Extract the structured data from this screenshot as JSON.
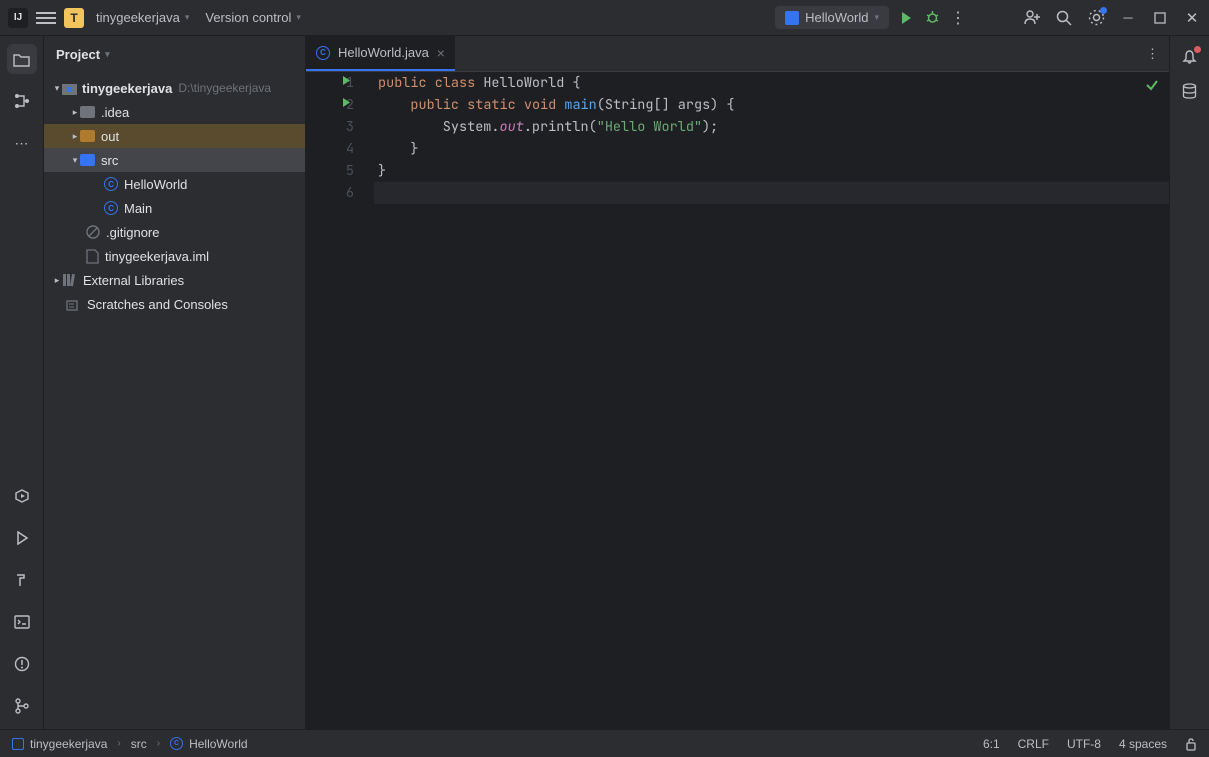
{
  "titlebar": {
    "project_initial": "T",
    "project_name": "tinygeekerjava",
    "vcs_menu": "Version control",
    "run_config": "HelloWorld"
  },
  "sidebar": {
    "header": "Project",
    "root": {
      "name": "tinygeekerjava",
      "path": "D:\\tinygeekerjava"
    },
    "idea": ".idea",
    "out": "out",
    "src": "src",
    "class1": "HelloWorld",
    "class2": "Main",
    "gitignore": ".gitignore",
    "iml": "tinygeekerjava.iml",
    "ext": "External Libraries",
    "scratch": "Scratches and Consoles"
  },
  "tab": {
    "name": "HelloWorld.java"
  },
  "code": {
    "l1_a": "public",
    "l1_b": "class",
    "l1_c": "HelloWorld",
    "l1_d": " {",
    "l2_a": "    ",
    "l2_b": "public",
    "l2_c": "static",
    "l2_d": "void",
    "l2_e": "main",
    "l2_f": "(String[] args) {",
    "l3_a": "        System.",
    "l3_b": "out",
    "l3_c": ".println(",
    "l3_d": "\"Hello World\"",
    "l3_e": ");",
    "l4": "    }",
    "l5": "}"
  },
  "gutter": {
    "1": "1",
    "2": "2",
    "3": "3",
    "4": "4",
    "5": "5",
    "6": "6"
  },
  "status": {
    "crumb1": "tinygeekerjava",
    "crumb2": "src",
    "crumb3": "HelloWorld",
    "pos": "6:1",
    "le": "CRLF",
    "enc": "UTF-8",
    "indent": "4 spaces"
  }
}
